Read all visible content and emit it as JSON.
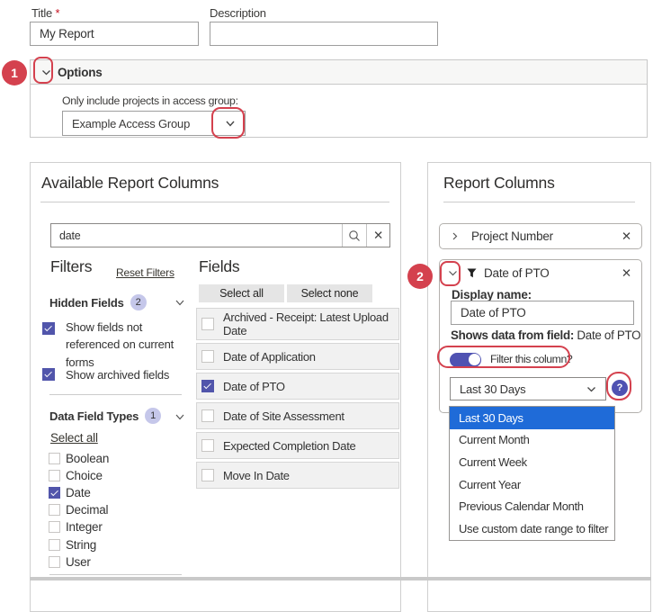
{
  "form": {
    "title_label": "Title",
    "required_mark": "*",
    "title_value": "My Report",
    "description_label": "Description",
    "description_value": ""
  },
  "options": {
    "header": "Options",
    "access_group_label": "Only include projects in access group:",
    "access_group_value": "Example Access Group"
  },
  "available": {
    "title": "Available Report Columns",
    "search_value": "date",
    "filters": {
      "heading": "Filters",
      "reset_link": "Reset Filters",
      "hidden_fields_label": "Hidden Fields",
      "hidden_fields_count": "2",
      "show_not_referenced_label": "Show fields not referenced on current forms",
      "show_archived_label": "Show archived fields",
      "data_field_types_label": "Data Field Types",
      "data_field_types_count": "1",
      "select_all_link": "Select all",
      "types": [
        {
          "label": "Boolean",
          "checked": false
        },
        {
          "label": "Choice",
          "checked": false
        },
        {
          "label": "Date",
          "checked": true
        },
        {
          "label": "Decimal",
          "checked": false
        },
        {
          "label": "Integer",
          "checked": false
        },
        {
          "label": "String",
          "checked": false
        },
        {
          "label": "User",
          "checked": false
        }
      ]
    },
    "fields": {
      "heading": "Fields",
      "select_all_button": "Select all",
      "select_none_button": "Select none",
      "items": [
        {
          "label": "Archived - Receipt: Latest Upload Date",
          "checked": false
        },
        {
          "label": "Date of Application",
          "checked": false
        },
        {
          "label": "Date of PTO",
          "checked": true
        },
        {
          "label": "Date of Site Assessment",
          "checked": false
        },
        {
          "label": "Expected Completion Date",
          "checked": false
        },
        {
          "label": "Move In Date",
          "checked": false
        }
      ]
    }
  },
  "report": {
    "title": "Report Columns",
    "collapsed_item": {
      "label": "Project Number"
    },
    "expanded_item": {
      "label": "Date of PTO",
      "display_name_label": "Display name:",
      "display_name_value": "Date of PTO",
      "shows_data_label": "Shows data from field:",
      "shows_data_value": "Date of PTO",
      "toggle_label": "Filter this column?",
      "select_value": "Last 30 Days",
      "dropdown_options": [
        "Last 30 Days",
        "Current Month",
        "Current Week",
        "Current Year",
        "Previous Calendar Month",
        "Use custom date range to filter"
      ],
      "selected_option_index": 0
    }
  },
  "annotations": {
    "step1": "1",
    "step2": "2"
  },
  "icons": {
    "check": "✓",
    "close": "✕",
    "question": "?"
  },
  "colors": {
    "accent": "#4f52b2",
    "highlight": "#1f6bd8",
    "annotation": "#d4414e"
  }
}
